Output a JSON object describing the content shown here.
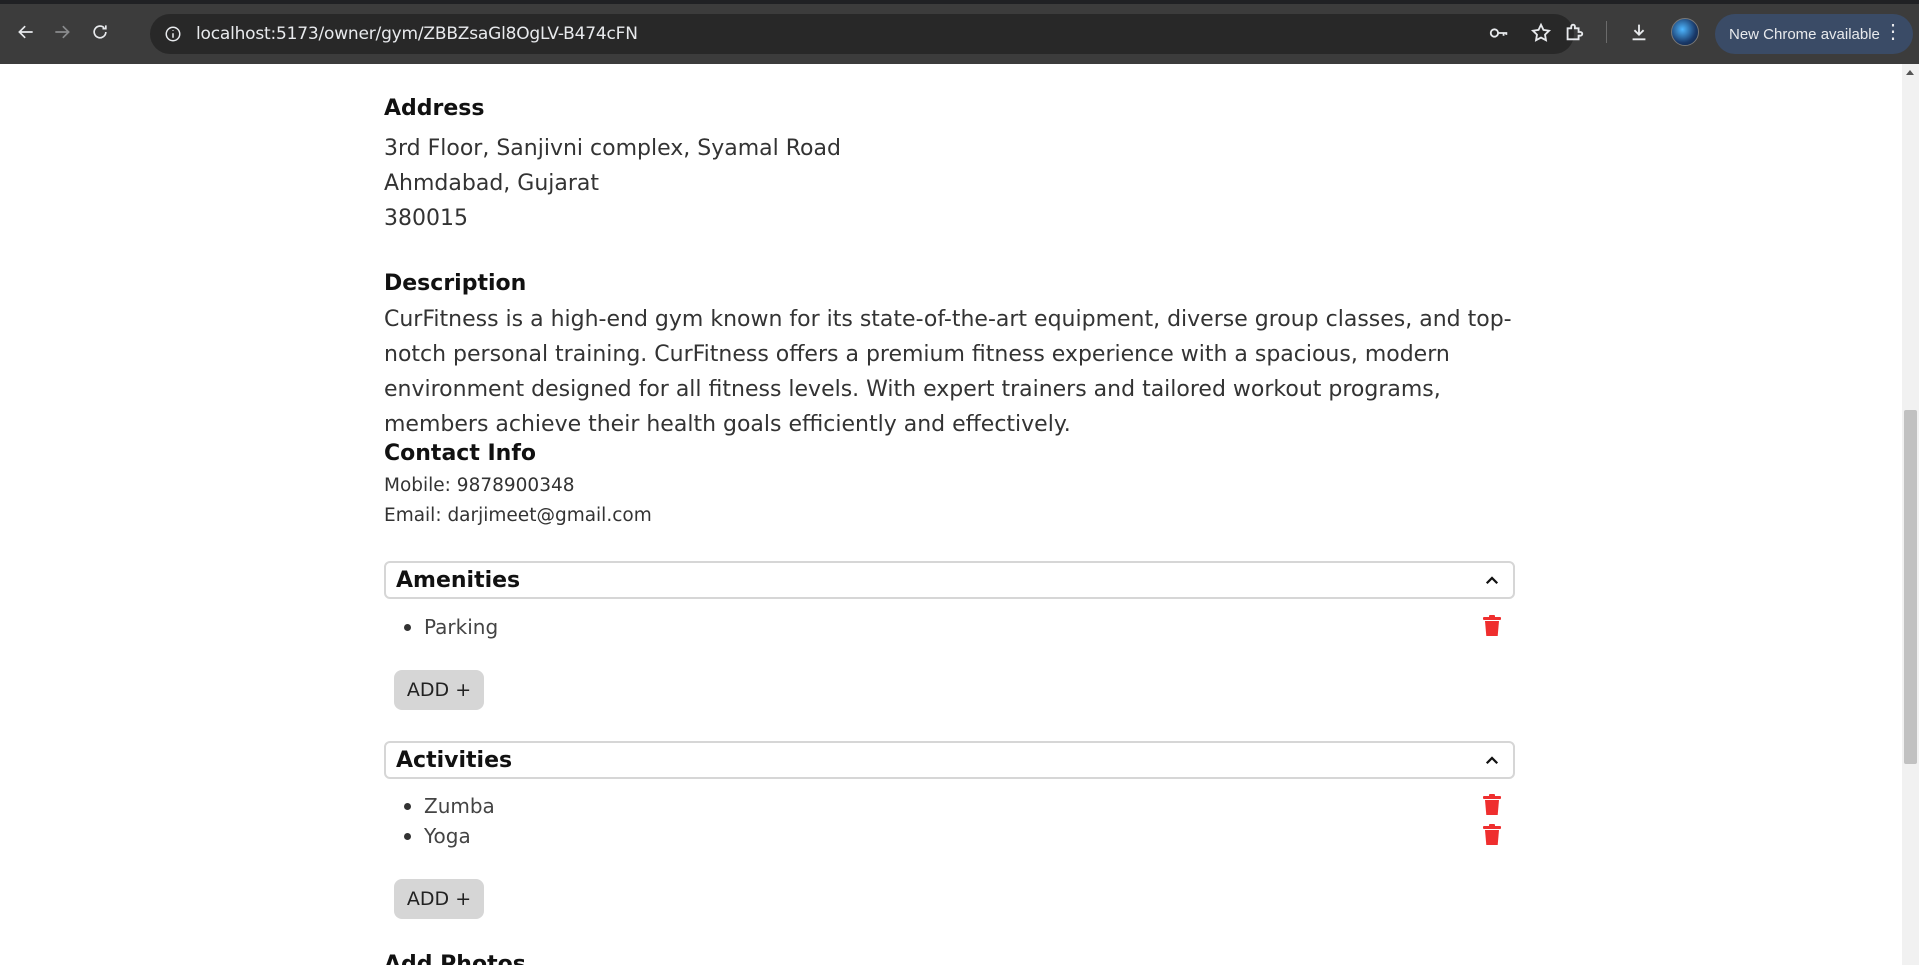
{
  "browser": {
    "url": "localhost:5173/owner/gym/ZBBZsaGl8OgLV-B474cFN",
    "update_label": "New Chrome available"
  },
  "address": {
    "title": "Address",
    "line1": "3rd Floor, Sanjivni complex, Syamal Road",
    "line2": "Ahmdabad, Gujarat",
    "line3": "380015"
  },
  "description": {
    "title": "Description",
    "text": "CurFitness is a high-end gym known for its state-of-the-art equipment, diverse group classes, and top-notch personal training. CurFitness offers a premium fitness experience with a spacious, modern environment designed for all fitness levels. With expert trainers and tailored workout programs, members achieve their health goals efficiently and effectively."
  },
  "contact": {
    "title": "Contact Info",
    "mobile": "Mobile: 9878900348",
    "email": "Email: darjimeet@gmail.com"
  },
  "amenities": {
    "title": "Amenities",
    "items": [
      "Parking"
    ],
    "add_label": "ADD +"
  },
  "activities": {
    "title": "Activities",
    "items": [
      "Zumba",
      "Yoga"
    ],
    "add_label": "ADD +"
  },
  "photos": {
    "title": "Add Photos"
  },
  "colors": {
    "trash": "#ef2e2e",
    "chrome_bg": "#3c3c3c",
    "update_pill": "#3a4b66"
  }
}
